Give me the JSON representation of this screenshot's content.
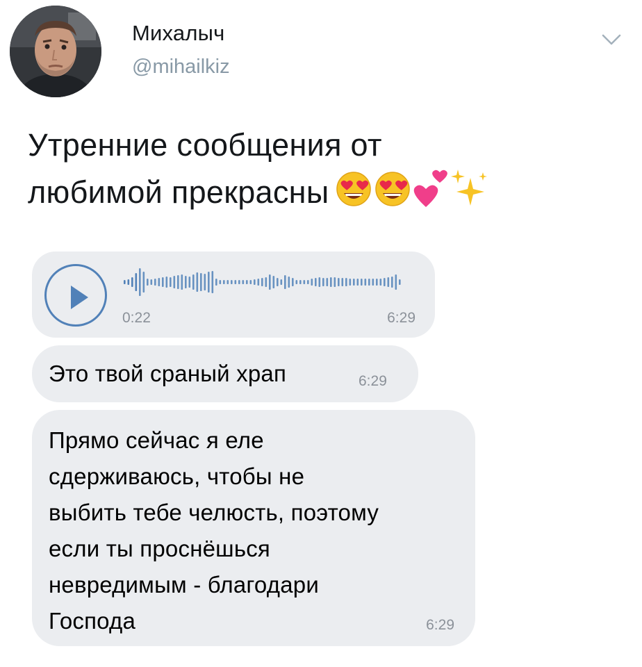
{
  "tweet": {
    "author_name": "Михалыч",
    "handle": "@mihailkiz",
    "text_lines": [
      "Утренние сообщения от",
      "любимой прекрасны"
    ],
    "emoji_names": [
      "heart-eyes-emoji",
      "heart-eyes-emoji",
      "two-hearts-emoji",
      "sparkles-emoji"
    ],
    "menu_icon": "chevron-down-icon"
  },
  "chat": {
    "voice_message": {
      "elapsed": "0:22",
      "time": "6:29",
      "play_icon": "play-icon",
      "progress_fraction": 0.06
    },
    "message_1": {
      "text": "Это твой сраный храп",
      "time": "6:29"
    },
    "message_2": {
      "lines": [
        "Прямо сейчас я еле",
        "сдерживаюсь, чтобы не",
        "выбить тебе челюсть, поэтому",
        "если ты проснёшься",
        "невредимым - благодари",
        "Господа"
      ],
      "time": "6:29"
    }
  },
  "colors": {
    "accent": "#5181b8",
    "bubble": "#ebedf0",
    "timestamp": "#8b9199",
    "handle": "#8899a6"
  }
}
